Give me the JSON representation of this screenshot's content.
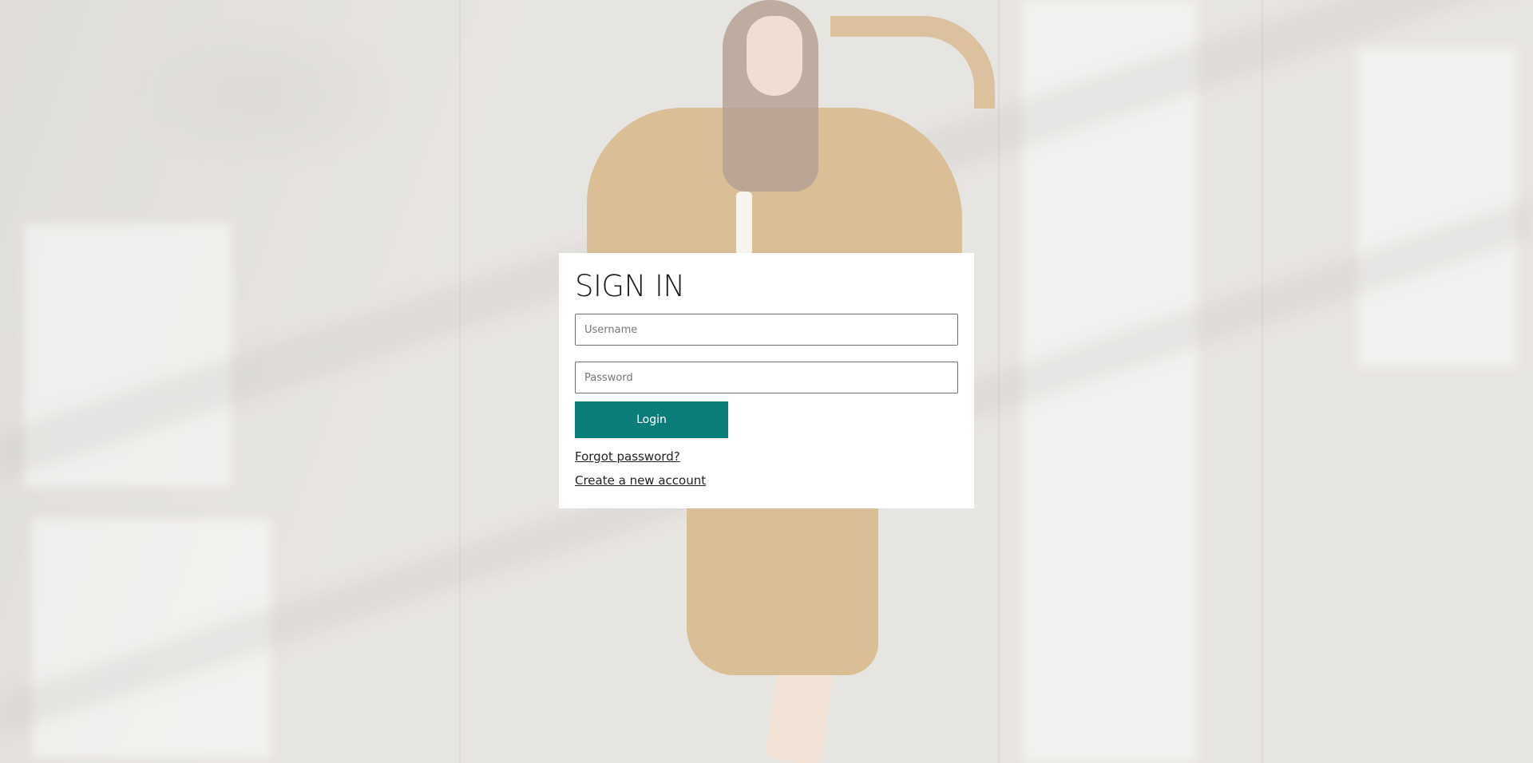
{
  "background": {
    "description_icon": "photo-background",
    "accent": "#c49655"
  },
  "signin": {
    "title": "SIGN IN",
    "username_placeholder": "Username",
    "password_placeholder": "Password",
    "login_label": "Login",
    "forgot_link": "Forgot password?",
    "create_link": "Create a new account",
    "button_color": "#0a7d7a"
  }
}
